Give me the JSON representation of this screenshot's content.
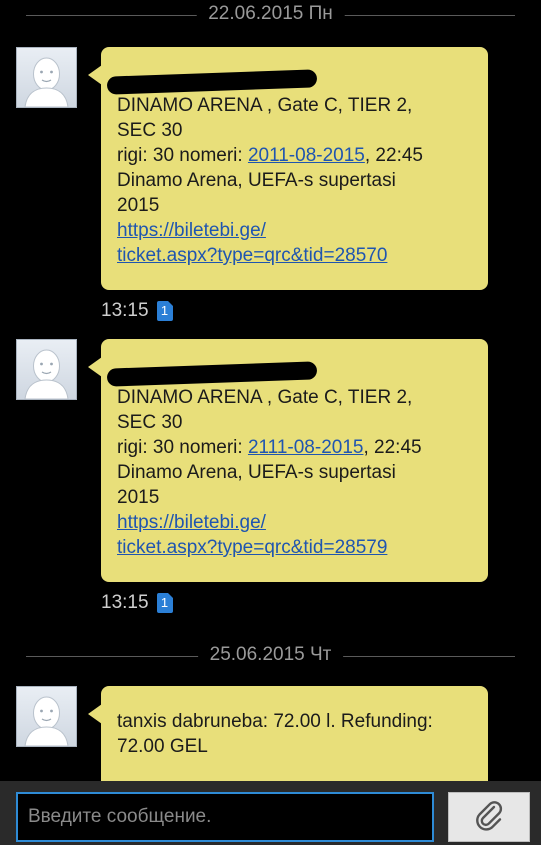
{
  "conversation": {
    "groups": [
      {
        "date": "22.06.2015 Пн"
      },
      {
        "date": "25.06.2015 Чт"
      }
    ],
    "messages": [
      {
        "redacted": true,
        "lines": [
          "DINAMO ARENA , Gate C, TIER 2,",
          "SEC 30"
        ],
        "rigi_prefix": "rigi: 30 nomeri: ",
        "rigi_link": "2011-08-2015",
        "rigi_suffix": ", 22:45",
        "lines2": [
          "Dinamo Arena, UEFA-s supertasi",
          "2015"
        ],
        "url": [
          "https://biletebi.ge/",
          "ticket.aspx?type=qrc&tid=28570"
        ],
        "time": "13:15",
        "sim": "1"
      },
      {
        "redacted": true,
        "lines": [
          "DINAMO ARENA , Gate C, TIER 2,",
          "SEC 30"
        ],
        "rigi_prefix": "rigi: 30 nomeri: ",
        "rigi_link": "2111-08-2015",
        "rigi_suffix": ", 22:45",
        "lines2": [
          "Dinamo Arena, UEFA-s supertasi",
          "2015"
        ],
        "url": [
          "https://biletebi.ge/",
          "ticket.aspx?type=qrc&tid=28579"
        ],
        "time": "13:15",
        "sim": "1"
      },
      {
        "lines": [
          "tanxis dabruneba: 72.00 l. Refunding:",
          "72.00 GEL"
        ]
      }
    ]
  },
  "composer": {
    "placeholder": "Введите сообщение."
  },
  "colors": {
    "bubble": "#e8df7a",
    "link": "#1f55b0",
    "input_border": "#2e8bd6",
    "sim_badge": "#2b7fd6"
  },
  "icons": [
    "avatar-icon",
    "sim-icon",
    "paperclip-icon"
  ]
}
